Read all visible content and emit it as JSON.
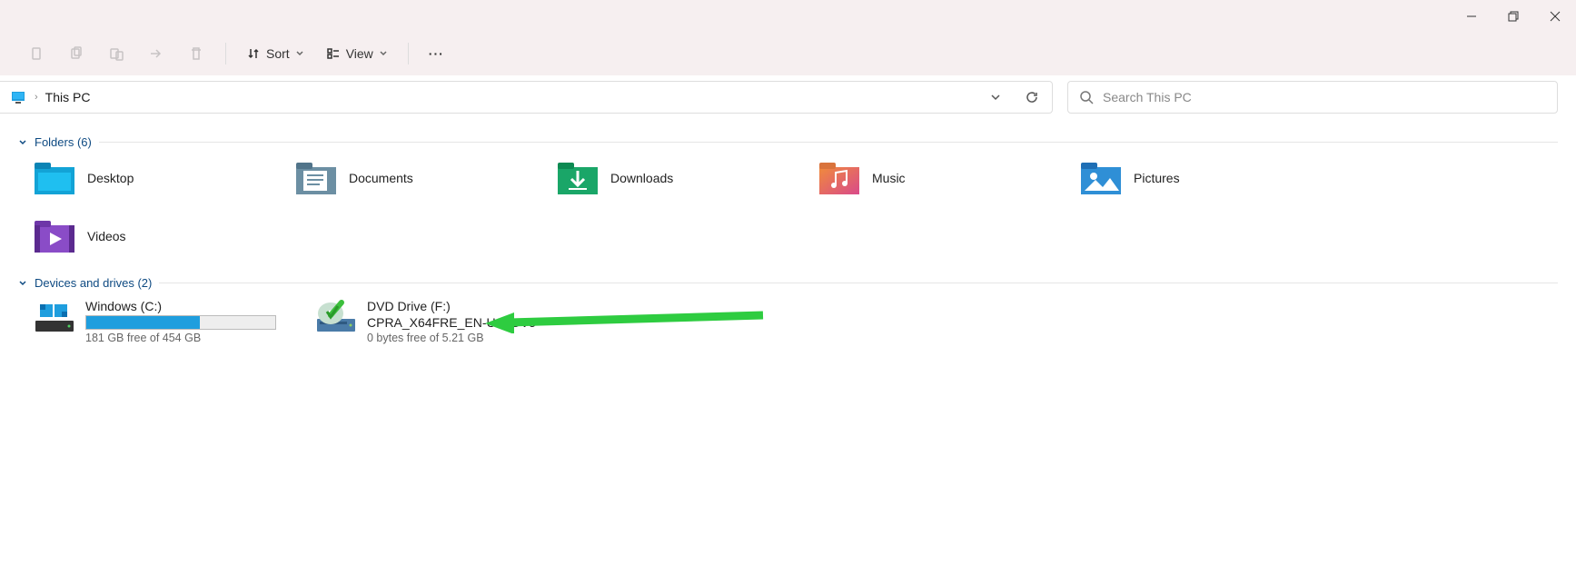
{
  "window": {
    "min": "—",
    "max": "▢",
    "close": "✕"
  },
  "toolbar": {
    "sort_label": "Sort",
    "view_label": "View",
    "more": "···"
  },
  "address": {
    "current": "This PC"
  },
  "search": {
    "placeholder": "Search This PC"
  },
  "groups": {
    "folders_header": "Folders (6)",
    "drives_header": "Devices and drives (2)"
  },
  "folders": [
    {
      "label": "Desktop"
    },
    {
      "label": "Documents"
    },
    {
      "label": "Downloads"
    },
    {
      "label": "Music"
    },
    {
      "label": "Pictures"
    },
    {
      "label": "Videos"
    }
  ],
  "drives": [
    {
      "name": "Windows (C:)",
      "free_text": "181 GB free of 454 GB",
      "fill_percent": 60
    },
    {
      "name": "DVD Drive (F:)",
      "label": "CPRA_X64FRE_EN-US_DV5",
      "free_text": "0 bytes free of 5.21 GB"
    }
  ]
}
